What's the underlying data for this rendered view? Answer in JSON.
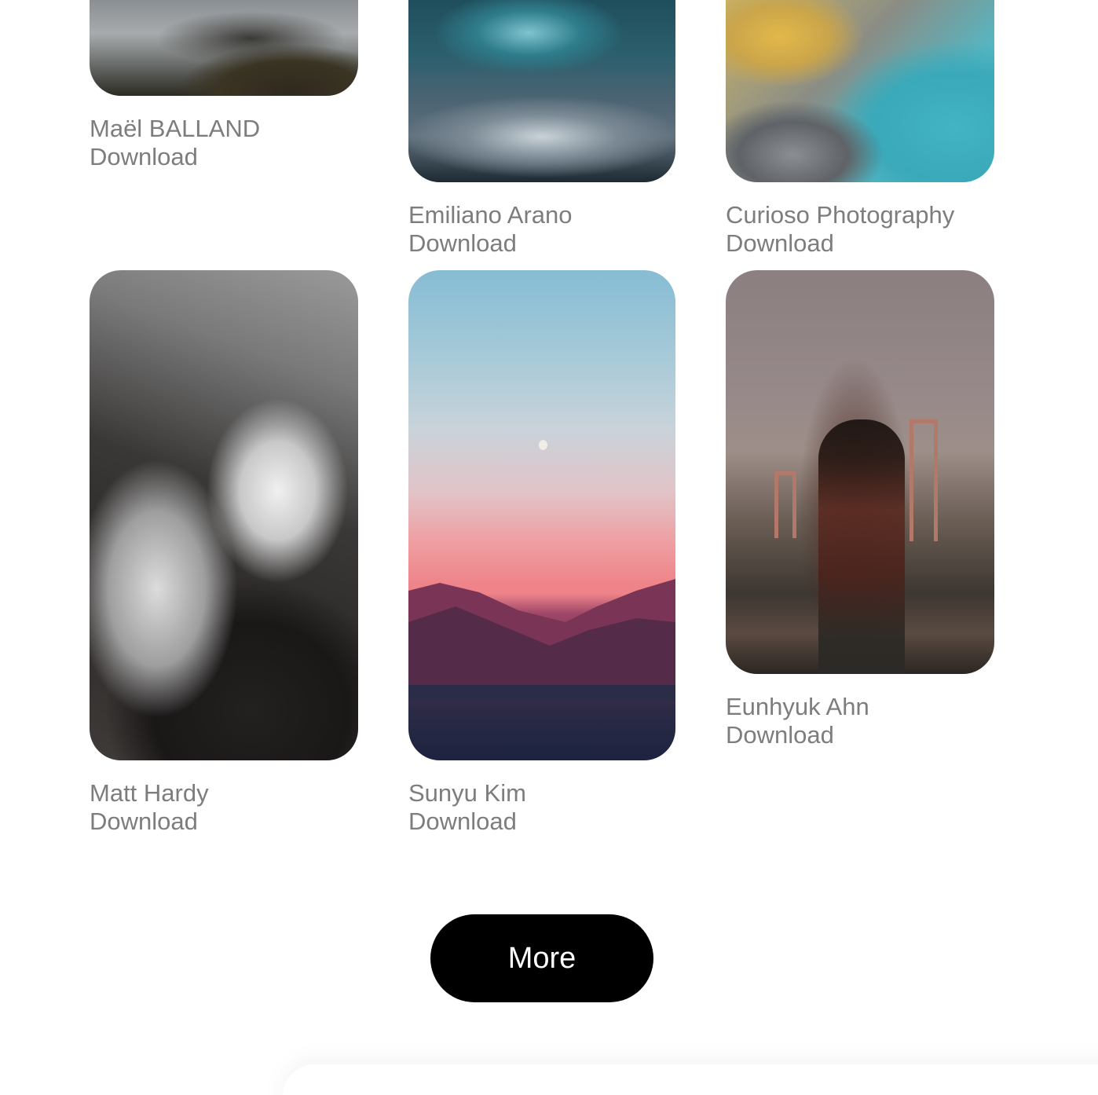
{
  "gallery": {
    "cards": [
      {
        "author": "Maël BALLAND",
        "download": "Download",
        "photo_subject": "rocky coastline with lighthouse path"
      },
      {
        "author": "Emiliano Arano",
        "download": "Download",
        "photo_subject": "teal ocean wave"
      },
      {
        "author": "Curioso Photography",
        "download": "Download",
        "photo_subject": "aerial yellow and turquoise terrain"
      },
      {
        "author": "Matt Hardy",
        "download": "Download",
        "photo_subject": "black and white crashing wave"
      },
      {
        "author": "Sunyu Kim",
        "download": "Download",
        "photo_subject": "pink sunset over mountains and lake with moon"
      },
      {
        "author": "Eunhyuk Ahn",
        "download": "Download",
        "photo_subject": "person in front of golden gate bridge"
      }
    ]
  },
  "more_button": {
    "label": "More"
  }
}
